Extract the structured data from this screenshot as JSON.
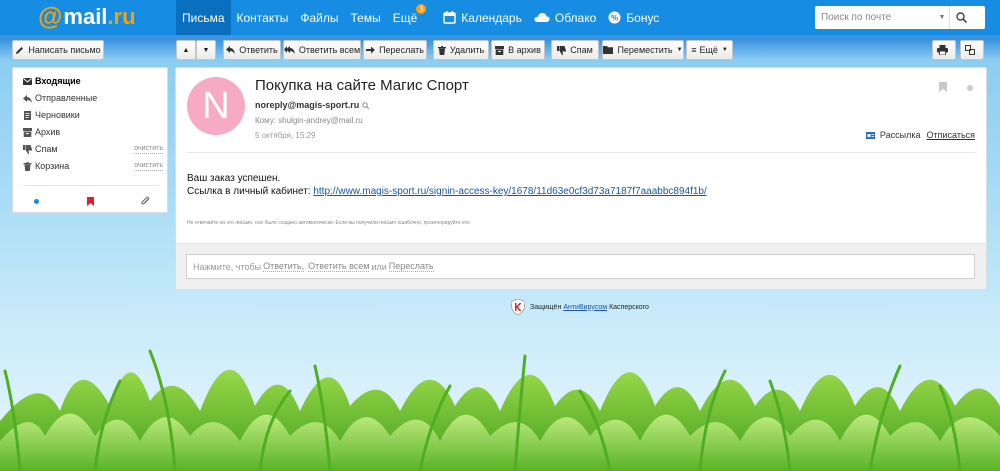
{
  "logo": {
    "at": "@",
    "name": "mail",
    "suffix": ".ru"
  },
  "nav": {
    "letters": "Письма",
    "contacts": "Контакты",
    "files": "Файлы",
    "topics": "Темы",
    "more": "Ещё",
    "more_badge": "3",
    "calendar": "Календарь",
    "cloud": "Облако",
    "bonus": "Бонус"
  },
  "search": {
    "placeholder": "Поиск по почте"
  },
  "toolbar": {
    "compose": "Написать письмо",
    "reply": "Ответить",
    "reply_all": "Ответить всем",
    "forward": "Переслать",
    "delete": "Удалить",
    "archive": "В архив",
    "spam": "Спам",
    "move": "Переместить",
    "more": "Ещё"
  },
  "folders": [
    {
      "label": "Входящие",
      "icon": "inbox-icon"
    },
    {
      "label": "Отправленные",
      "icon": "sent-icon"
    },
    {
      "label": "Черновики",
      "icon": "drafts-icon"
    },
    {
      "label": "Архив",
      "icon": "archive-icon"
    },
    {
      "label": "Спам",
      "icon": "spam-icon",
      "action": "очистить"
    },
    {
      "label": "Корзина",
      "icon": "trash-icon",
      "action": "очистить"
    }
  ],
  "message": {
    "avatar_letter": "N",
    "subject": "Покупка на сайте Магис Спорт",
    "from": "noreply@magis-sport.ru",
    "to_label": "Кому:",
    "to": "shulgin-andrey@mail.ru",
    "date": "5 октября, 15:29",
    "mailing_label": "Рассылка",
    "unsubscribe": "Отписаться",
    "line1": "Ваш заказ успешен.",
    "line2_prefix": "Ссылка в личный кабинет:",
    "link": "http://www.magis-sport.ru/signin-access-key/1678/11d63e0cf3d73a7187f7aaabbc894f1b/",
    "footnote": "Не отвечайте на это письмо, оно было создано автоматически. Если вы получили письмо ошибочно, проигнорируйте его."
  },
  "reply": {
    "prefix": "Нажмите, чтобы",
    "reply": "Ответить,",
    "reply_all": "Ответить всем",
    "or": "или",
    "forward": "Переслать"
  },
  "kaspersky": {
    "prefix": "Защищён",
    "link": "АнтиВирусом",
    "suffix": "Касперского"
  },
  "colors": {
    "topbar": "#168de2",
    "topbar_active": "#0a6fbf",
    "accent_orange": "#ff9e00",
    "avatar": "#f6aac4",
    "link": "#1a55a6"
  }
}
